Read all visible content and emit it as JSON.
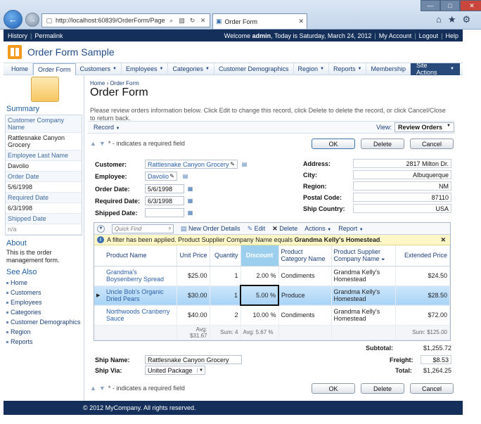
{
  "browser": {
    "url": "http://localhost:60839/OrderForm/Page",
    "tab_title": "Order Form",
    "colors": {
      "accent": "#14305a"
    }
  },
  "topbar": {
    "history": "History",
    "permalink": "Permalink",
    "welcome_prefix": "Welcome ",
    "user": "admin",
    "welcome_suffix": ", Today is Saturday, March 24, 2012",
    "my_account": "My Account",
    "logout": "Logout",
    "help": "Help"
  },
  "app": {
    "title": "Order Form Sample"
  },
  "menu": {
    "items": [
      {
        "label": "Home",
        "dd": false
      },
      {
        "label": "Order Form",
        "dd": false
      },
      {
        "label": "Customers",
        "dd": true
      },
      {
        "label": "Employees",
        "dd": true
      },
      {
        "label": "Categories",
        "dd": true
      },
      {
        "label": "Customer Demographics",
        "dd": false
      },
      {
        "label": "Region",
        "dd": true
      },
      {
        "label": "Reports",
        "dd": true
      },
      {
        "label": "Membership",
        "dd": false
      }
    ],
    "site_actions": "Site Actions"
  },
  "sidebar": {
    "summary_title": "Summary",
    "rows": [
      {
        "l": "Customer Company Name",
        "v": "Rattlesnake Canyon Grocery"
      },
      {
        "l": "Employee Last Name",
        "v": "Davolio"
      },
      {
        "l": "Order Date",
        "v": "5/6/1998"
      },
      {
        "l": "Required Date",
        "v": "6/3/1998"
      },
      {
        "l": "Shipped Date",
        "v": "n/a"
      }
    ],
    "about_title": "About",
    "about_text": "This is the order management form.",
    "see_also_title": "See Also",
    "links": [
      "Home",
      "Customers",
      "Employees",
      "Categories",
      "Customer Demographics",
      "Region",
      "Reports"
    ]
  },
  "page": {
    "crumb_home": "Home",
    "crumb_current": "Order Form",
    "title": "Order Form",
    "description": "Please review orders information below. Click Edit to change this record, click Delete to delete the record, or click Cancel/Close to return back.",
    "record_menu": "Record",
    "view_label": "View:",
    "view_value": "Review Orders",
    "required_note": "* - indicates a required field",
    "ok": "OK",
    "delete": "Delete",
    "cancel": "Cancel"
  },
  "form": {
    "customer_label": "Customer:",
    "customer": "Rattlesnake Canyon Grocery",
    "employee_label": "Employee:",
    "employee": "Davolio",
    "order_date_label": "Order Date:",
    "order_date": "5/6/1998",
    "required_date_label": "Required Date:",
    "required_date": "6/3/1998",
    "shipped_date_label": "Shipped Date:",
    "shipped_date": "",
    "address_label": "Address:",
    "address": "2817 Milton Dr.",
    "city_label": "City:",
    "city": "Albuquerque",
    "region_label": "Region:",
    "region": "NM",
    "postal_label": "Postal Code:",
    "postal": "87110",
    "country_label": "Ship Country:",
    "country": "USA"
  },
  "grid": {
    "quick_find": "Quick Find",
    "new_details": "New Order Details",
    "edit": "Edit",
    "delete": "Delete",
    "actions": "Actions",
    "report": "Report",
    "filter_text": "A filter has been applied. Product Supplier Company Name equals ",
    "filter_value": "Grandma Kelly's Homestead",
    "filter_suffix": ".",
    "columns": [
      "Product Name",
      "Unit Price",
      "Quantity",
      "Discount",
      "Product Category Name",
      "Product Supplier Company Name",
      "Extended Price"
    ],
    "rows": [
      {
        "product": "Grandma's Boysenberry Spread",
        "price": "$25.00",
        "qty": "1",
        "disc": "2.00 %",
        "cat": "Condiments",
        "supplier": "Grandma Kelly's Homestead",
        "ext": "$24.50"
      },
      {
        "product": "Uncle Bob's Organic Dried Pears",
        "price": "$30.00",
        "qty": "1",
        "disc": "5.00 %",
        "cat": "Produce",
        "supplier": "Grandma Kelly's Homestead",
        "ext": "$28.50"
      },
      {
        "product": "Northwoods Cranberry Sauce",
        "price": "$40.00",
        "qty": "2",
        "disc": "10.00 %",
        "cat": "Condiments",
        "supplier": "Grandma Kelly's Homestead",
        "ext": "$72.00"
      }
    ],
    "agg_price": "Avg: $31.67",
    "agg_qty": "Sum: 4",
    "agg_disc": "Avg: 5.67 %",
    "agg_ext": "Sum: $125.00"
  },
  "totals": {
    "subtotal_label": "Subtotal:",
    "subtotal": "$1,255.72",
    "freight_label": "Freight:",
    "freight": "$8.53",
    "total_label": "Total:",
    "total": "$1,264.25"
  },
  "ship": {
    "name_label": "Ship Name:",
    "name": "Rattlesnake Canyon Grocery",
    "via_label": "Ship Via:",
    "via": "United Package"
  },
  "footer": {
    "text": "© 2012 MyCompany. All rights reserved."
  }
}
